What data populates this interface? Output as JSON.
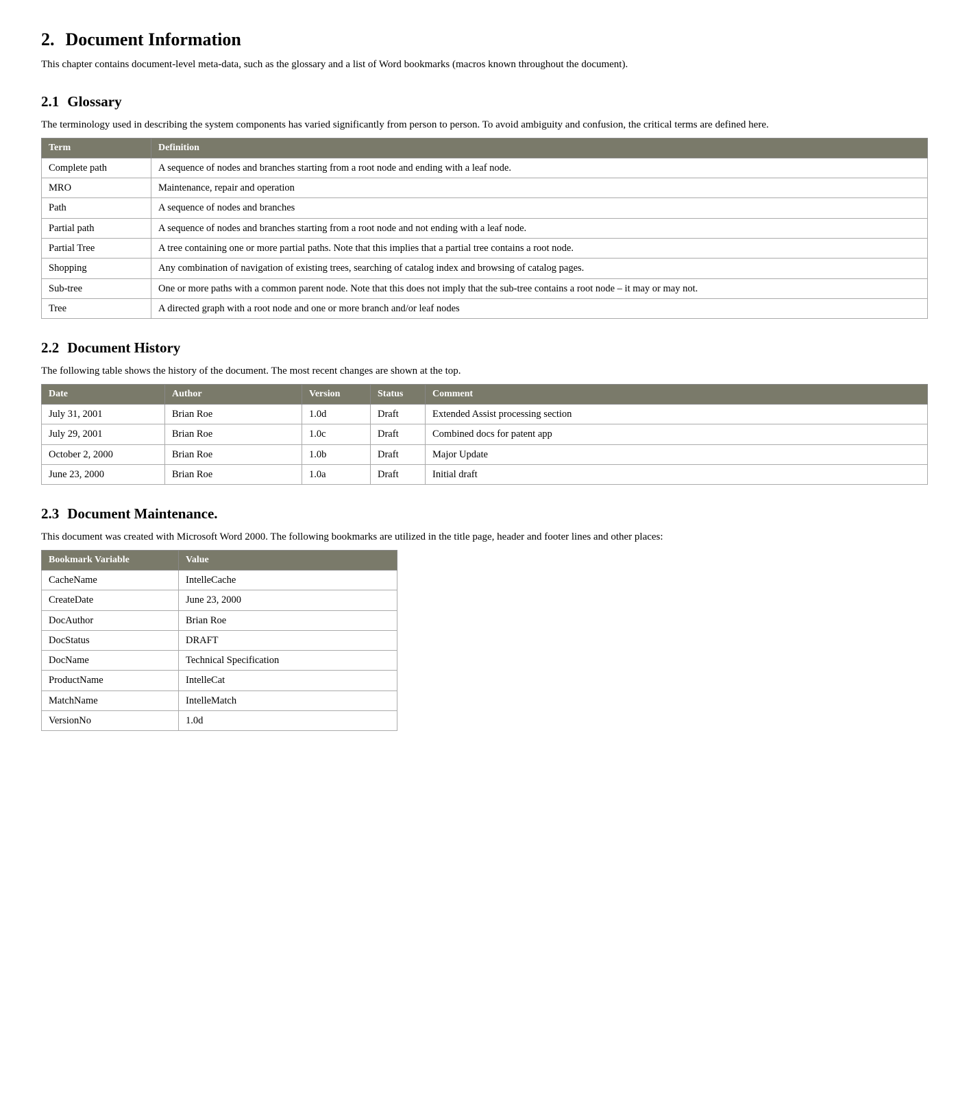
{
  "chapter": {
    "number": "2.",
    "title": "Document Information",
    "intro": "This chapter contains document-level meta-data, such as the glossary and a list of Word bookmarks (macros known throughout the document)."
  },
  "section21": {
    "number": "2.1",
    "title": "Glossary",
    "intro": "The terminology used in describing the system components has varied significantly from person to person.  To avoid ambiguity and confusion, the critical terms are defined here.",
    "table_headers": [
      "Term",
      "Definition"
    ],
    "rows": [
      {
        "term": "Complete path",
        "definition": "A sequence of nodes and branches starting from a root node and ending with a leaf node."
      },
      {
        "term": "MRO",
        "definition": "Maintenance, repair and operation"
      },
      {
        "term": "Path",
        "definition": "A sequence of nodes and branches"
      },
      {
        "term": "Partial path",
        "definition": "A sequence of nodes and branches starting from a root node and not ending with a leaf node."
      },
      {
        "term": "Partial Tree",
        "definition": "A tree containing one or more partial paths.  Note that this implies that a partial tree contains a root node."
      },
      {
        "term": "Shopping",
        "definition": "Any combination of navigation of existing trees, searching of catalog index and browsing of catalog pages."
      },
      {
        "term": "Sub-tree",
        "definition": "One or more paths with a common parent node.  Note that this does not imply that the sub-tree contains a root node – it may or may not."
      },
      {
        "term": "Tree",
        "definition": "A directed graph with a root node and one or more branch and/or leaf nodes"
      }
    ]
  },
  "section22": {
    "number": "2.2",
    "title": "Document History",
    "intro": "The following table shows the history of the document.  The most recent changes are shown at the top.",
    "table_headers": [
      "Date",
      "Author",
      "Version",
      "Status",
      "Comment"
    ],
    "rows": [
      {
        "date": "July 31, 2001",
        "author": "Brian Roe",
        "version": "1.0d",
        "status": "Draft",
        "comment": "Extended Assist processing section"
      },
      {
        "date": "July 29, 2001",
        "author": "Brian Roe",
        "version": "1.0c",
        "status": "Draft",
        "comment": "Combined docs for patent app"
      },
      {
        "date": "October 2, 2000",
        "author": "Brian Roe",
        "version": "1.0b",
        "status": "Draft",
        "comment": "Major Update"
      },
      {
        "date": "June 23, 2000",
        "author": "Brian Roe",
        "version": "1.0a",
        "status": "Draft",
        "comment": "Initial draft"
      }
    ]
  },
  "section23": {
    "number": "2.3",
    "title": "Document Maintenance.",
    "intro": "This document was created with Microsoft Word 2000. The following bookmarks are utilized in the title page, header and footer lines and other places:",
    "table_headers": [
      "Bookmark Variable",
      "Value"
    ],
    "rows": [
      {
        "variable": "CacheName",
        "value": "IntelleCache"
      },
      {
        "variable": "CreateDate",
        "value": "June 23, 2000"
      },
      {
        "variable": "DocAuthor",
        "value": "Brian Roe"
      },
      {
        "variable": "DocStatus",
        "value": "DRAFT"
      },
      {
        "variable": "DocName",
        "value": "Technical Specification"
      },
      {
        "variable": "ProductName",
        "value": "IntelleCat"
      },
      {
        "variable": "MatchName",
        "value": "IntelleMatch"
      },
      {
        "variable": "VersionNo",
        "value": "1.0d"
      }
    ]
  }
}
